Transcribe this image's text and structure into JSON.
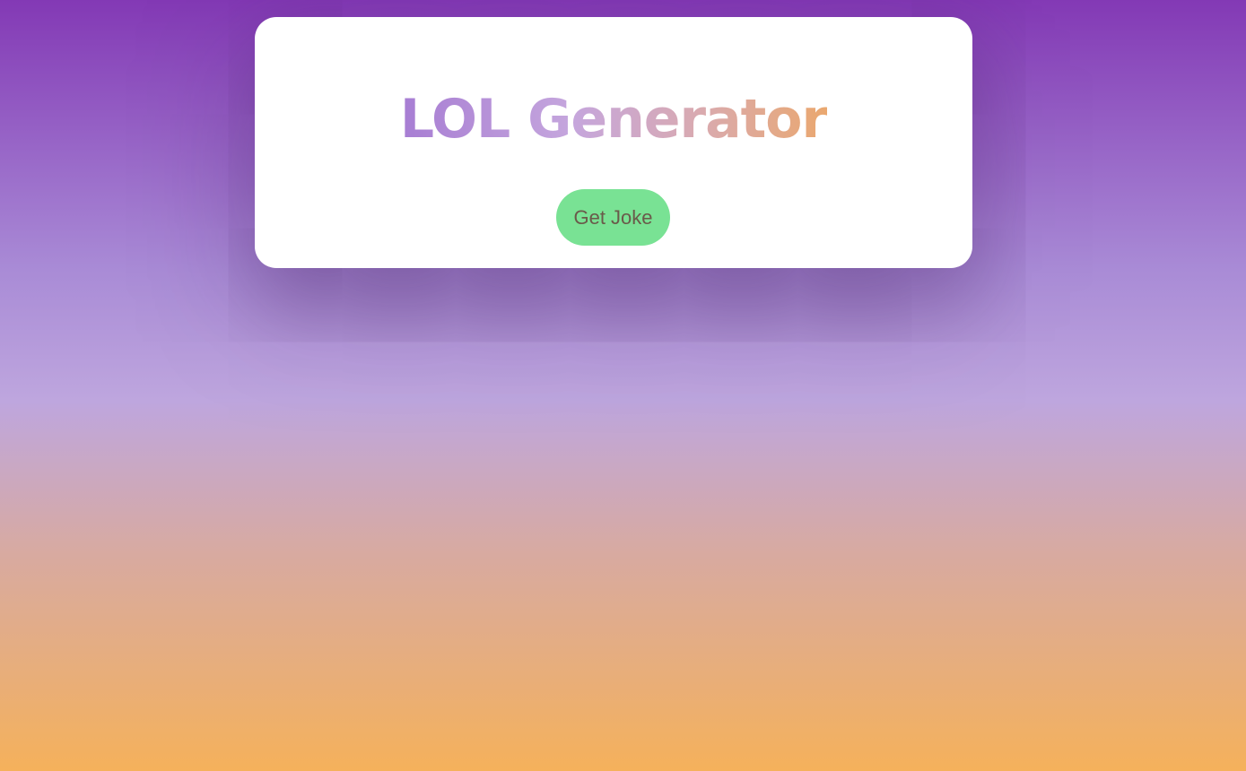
{
  "app": {
    "title": "LOL Generator",
    "get_joke_label": "Get Joke"
  },
  "colors": {
    "background_top": "#8339b5",
    "background_bottom": "#f5b15b",
    "title_gradient_start": "#a77dd3",
    "title_gradient_end": "#eaa86f",
    "button": "#79e294",
    "button_text": "#6a5a4a",
    "card": "#ffffff"
  }
}
